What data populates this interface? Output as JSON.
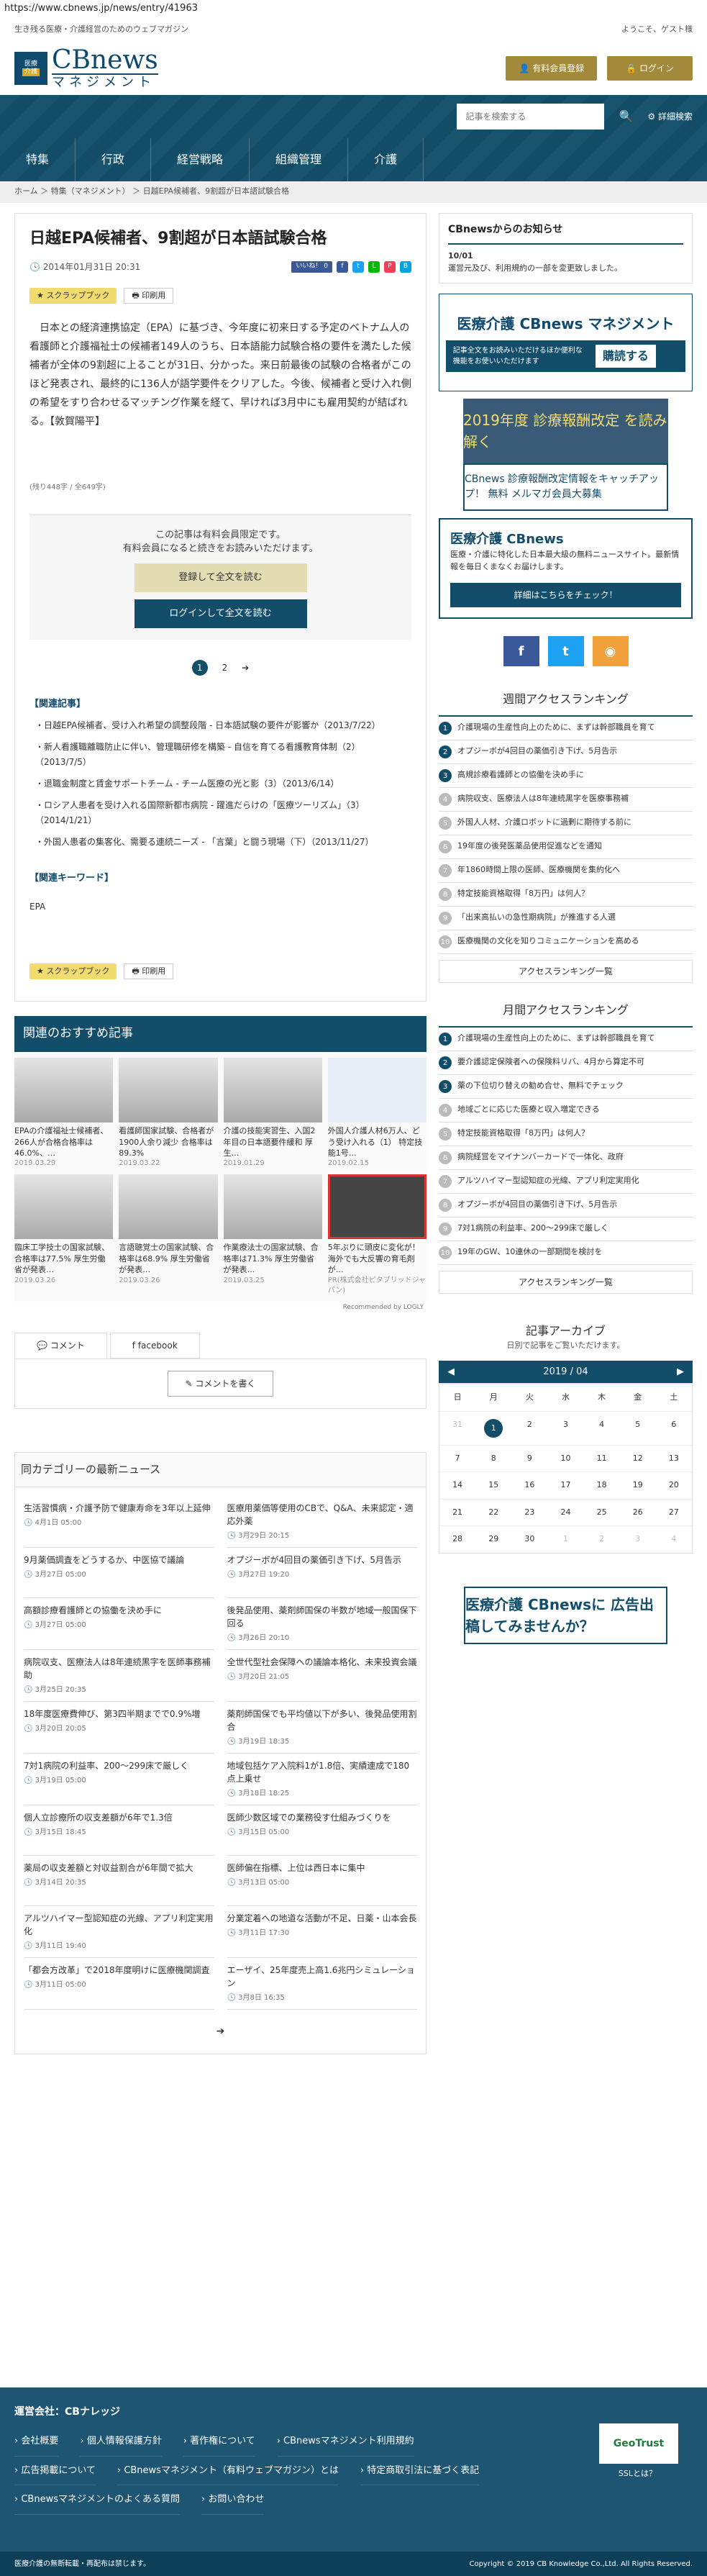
{
  "browser": {
    "url": "https://www.cbnews.jp/news/entry/41963"
  },
  "top": {
    "tagline": "生き残る医療・介護経営のためのウェブマガジン",
    "greeting": "ようこそ、ゲスト様"
  },
  "logo": {
    "badge_top": "医療",
    "badge_bottom": "介護",
    "main": "CBnews",
    "sub": "マネジメント"
  },
  "header": {
    "member_btn": "有料会員登録",
    "login_btn": "ログイン"
  },
  "search": {
    "placeholder": "記事を検索する",
    "detail": "詳細検索"
  },
  "nav": [
    "特集",
    "行政",
    "経営戦略",
    "組織管理",
    "介護"
  ],
  "breadcrumb": {
    "home": "ホーム",
    "section": "特集（マネジメント）",
    "current": "日越EPA候補者、9割超が日本語試験合格"
  },
  "article": {
    "title": "日越EPA候補者、9割超が日本語試験合格",
    "date": "2014年01月31日 20:31",
    "like": "いいね！ 0",
    "scrap": "スクラップブック",
    "print": "印刷用",
    "body": "日本との経済連携協定（EPA）に基づき、今年度に初来日する予定のベトナム人の看護師と介護福祉士の候補者149人のうち、日本語能力試験合格の要件を満たした候補者が全体の9割超に上ることが31日、分かった。来日前最後の試験の合格者がこのほど発表され、最終的に136人が語学要件をクリアした。今後、候補者と受け入れ側の希望をすり合わせるマッチング作業を経て、早ければ3月中にも雇用契約が結ばれる。【敦賀陽平】",
    "count": "(残り448字 / 全649字)",
    "paywall_msg1": "この記事は有料会員限定です。",
    "paywall_msg2": "有料会員になると続きをお読みいただけます。",
    "register_btn": "登録して全文を読む",
    "login_btn": "ログインして全文を読む",
    "page1": "1",
    "page2": "2",
    "page_next": "➔",
    "related_h": "【関連記事】",
    "related": [
      {
        "t": "日越EPA候補者、受け入れ希望の調整段階 - 日本語試験の要件が影響か",
        "d": "（2013/7/22）"
      },
      {
        "t": "新人看護職離職防止に伴い、管理職研修を構築 - 自信を育てる看護教育体制（2）",
        "d": "（2013/7/5）"
      },
      {
        "t": "退職金制度と賃金サポートチーム - チーム医療の光と影（3）（2013/6/14）",
        "d": ""
      },
      {
        "t": "ロシア人患者を受け入れる国際新都市病院 - 躍進だらけの「医療ツーリズム」（3）（2014/1/21）",
        "d": ""
      },
      {
        "t": "外国人患者の集客化、需要る連続ニーズ - 「言葉」と闘う現場（下）",
        "d": "（2013/11/27）"
      }
    ],
    "keyword_h": "【関連キーワード】",
    "keyword": "EPA"
  },
  "recs": {
    "title": "関連のおすすめ記事",
    "logly": "Recommended by LOGLY",
    "items": [
      {
        "t": "EPAの介護福祉士候補者、266人が合格合格率は46.0%、…",
        "d": "2019.03.29"
      },
      {
        "t": "看護師国家試験、合格者が1900人余り減少 合格率は89.3%",
        "d": "2019.03.22"
      },
      {
        "t": "介護の技能実習生、入国2年目の日本語要件緩和 厚生…",
        "d": "2019.01.29"
      },
      {
        "t": "外国人介護人材6万人、どう受け入れる（1） 特定技能1号…",
        "d": "2019.02.15"
      },
      {
        "t": "臨床工学技士の国家試験、合格率は77.5% 厚生労働省が発表…",
        "d": "2019.03.26"
      },
      {
        "t": "言語聴覚士の国家試験、合格率は68.9% 厚生労働省が発表…",
        "d": "2019.03.26"
      },
      {
        "t": "作業療法士の国家試験、合格率は71.3% 厚生労働省が発表…",
        "d": "2019.03.25"
      },
      {
        "t": "5年ぶりに頭皮に変化が！海外でも大反響の育毛剤が…",
        "d": "PR(株式会社ピタブリッドジャパン)"
      }
    ]
  },
  "comments": {
    "tab_comment": "コメント",
    "tab_facebook": "facebook",
    "write_btn": "コメントを書く"
  },
  "catnews": {
    "title": "同カテゴリーの最新ニュース",
    "more": "➔",
    "items": [
      {
        "t": "生活習慣病・介護予防で健康寿命を3年以上延伸",
        "d": "4月1日 05:00"
      },
      {
        "t": "医療用薬価等使用のCBで、Q&A、未来認定・適応外薬",
        "d": "3月29日 20:15"
      },
      {
        "t": "9月薬価調査をどうするか、中医協で議論",
        "d": "3月27日 05:00"
      },
      {
        "t": "オプジーボが4回目の薬価引き下げ、5月告示",
        "d": "3月27日 19:20"
      },
      {
        "t": "高額診療看護師との協働を決め手に",
        "d": "3月27日 05:00"
      },
      {
        "t": "後発品使用、薬剤師国保の半数が地域一般国保下回る",
        "d": "3月26日 20:10"
      },
      {
        "t": "病院収支、医療法人は8年連続黒字を医師事務補助",
        "d": "3月25日 20:35"
      },
      {
        "t": "全世代型社会保障への議論本格化、未来投資会議",
        "d": "3月20日 21:05"
      },
      {
        "t": "18年度医療費伸び、第3四半期までで0.9%増",
        "d": "3月20日 20:05"
      },
      {
        "t": "薬剤師国保でも平均値以下が多い、後発品使用割合",
        "d": "3月19日 18:35"
      },
      {
        "t": "7対1病院の利益率、200～299床で厳しく",
        "d": "3月19日 05:00"
      },
      {
        "t": "地域包括ケア入院料1が1.8倍、実績連成で180点上乗せ",
        "d": "3月18日 18:25"
      },
      {
        "t": "個人立診療所の収支差額が6年で1.3倍",
        "d": "3月15日 18:45"
      },
      {
        "t": "医師少数区域での業務役す仕組みづくりを",
        "d": "3月15日 05:00"
      },
      {
        "t": "薬局の収支差額と対収益割合が6年間で拡大",
        "d": "3月14日 20:35"
      },
      {
        "t": "医師偏在指標、上位は西日本に集中",
        "d": "3月13日 05:00"
      },
      {
        "t": "アルツハイマー型認知症の光線、アプリ利定実用化",
        "d": "3月11日 19:40"
      },
      {
        "t": "分業定着への地道な活動が不足、日薬・山本会長",
        "d": "3月11日 17:30"
      },
      {
        "t": "「都会方改革」で2018年度明けに医療機関調査",
        "d": "3月11日 05:00"
      },
      {
        "t": "エーザイ、25年度売上高1.6兆円シミュレーション",
        "d": "3月8日 16:35"
      }
    ]
  },
  "side": {
    "notice_h": "CBnewsからのお知らせ",
    "notice_date": "10/01",
    "notice_text": "運営元及び、利用規約の一部を変更致しました。",
    "bn1_line1": "医療介護 CBnews マネジメント",
    "bn1_line2": "記事全文をお読みいただけるほか便利な機能をお使いいただけます",
    "bn1_cta": "購読する",
    "bn2": "2019年度 診療報酬改定 を読み解く",
    "bn3": "CBnews 診療報酬改定情報をキャッチアップ！ 無料 メルマガ会員大募集",
    "free_title": "医療介護 CBnews",
    "free_text": "医療・介護に特化した日本最大級の無料ニュースサイト。最新情報を毎日くまなくお届けします。",
    "free_btn": "詳細はこちらをチェック！",
    "weekly_h": "週間アクセスランキング",
    "weekly": [
      "介護現場の生産性向上のために、まずは幹部職員を育て",
      "オプジーボが4回目の薬価引き下げ、5月告示",
      "高規診療看護師との協働を決め手に",
      "病院収支、医療法人は8年連続黒字を医療事務補",
      "外国人人材、介護ロボットに過剰に期待する前に",
      "19年度の後発医薬品使用促進などを通知",
      "年1860時間上限の医師、医療機関を集約化へ",
      "特定技能資格取得「8万円」は何人？",
      "「出来高払いの急性期病院」が推進する人選",
      "医療機関の文化を知りコミュニケーションを高める"
    ],
    "weekly_more": "アクセスランキング一覧",
    "monthly_h": "月間アクセスランキング",
    "monthly": [
      "介護現場の生産性向上のために、まずは幹部職員を育て",
      "要介護認定保険者への保険料リバ、4月から算定不可",
      "薬の下位切り替えの勧め合せ、無料でチェック",
      "地域ごとに応じた医療と収入増定できる",
      "特定技能資格取得「8万円」は何人？",
      "病院経営をマイナンバーカードで一体化、政府",
      "アルツハイマー型認知症の光線、アプリ利定実用化",
      "オプジーボが4回目の薬価引き下げ、5月告示",
      "7対1病院の利益率、200～299床で厳しく",
      "19年のGW、10連休の一部期間を検討を"
    ],
    "monthly_more": "アクセスランキング一覧",
    "archive_h": "記事アーカイブ",
    "archive_sub": "日別で記事をご覧いただけます。",
    "cal_month": "2019 / 04",
    "cal_prev": "◀",
    "cal_next": "▶",
    "cal_days": [
      "日",
      "月",
      "火",
      "水",
      "木",
      "金",
      "土"
    ],
    "cal_cells": [
      "31",
      "1",
      "2",
      "3",
      "4",
      "5",
      "6",
      "7",
      "8",
      "9",
      "10",
      "11",
      "12",
      "13",
      "14",
      "15",
      "16",
      "17",
      "18",
      "19",
      "20",
      "21",
      "22",
      "23",
      "24",
      "25",
      "26",
      "27",
      "28",
      "29",
      "30",
      "1",
      "2",
      "3",
      "4"
    ],
    "ad_bottom": "医療介護 CBnewsに 広告出稿してみませんか？"
  },
  "footer": {
    "company": "運営会社：CBナレッジ",
    "links": [
      "会社概要",
      "個人情報保護方針",
      "著作権について",
      "CBnewsマネジメント利用規約",
      "広告掲載について",
      "CBnewsマネジメント（有料ウェブマガジン）とは",
      "特定商取引法に基づく表記",
      "CBnewsマネジメントのよくある質問",
      "お問い合わせ"
    ],
    "geotrust": "GeoTrust",
    "ssl": "SSLとは？",
    "left_copy": "医療介護の無断転載・再配布は禁じます。",
    "right_copy": "Copyright © 2019 CB Knowledge Co.,Ltd. All Rights Reserved."
  },
  "colors": {
    "primary": "#124e6a",
    "accent": "#a28a3a"
  }
}
